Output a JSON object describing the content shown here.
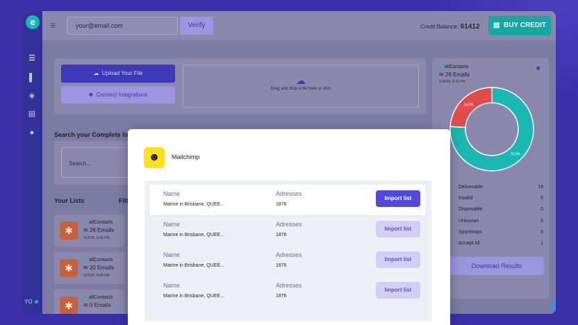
{
  "app": {
    "logo_text": "e",
    "user_initials": "YO"
  },
  "topbar": {
    "email_value": "your@email.com",
    "verify_label": "Verify",
    "credit_label": "Credit Balance:",
    "credit_value": "61412",
    "buy_label": "BUY CREDIT"
  },
  "upload": {
    "upload_label": "Upload Your File",
    "connect_label": "Connect Integrations",
    "drop_text": "Drag and drop a file here or click"
  },
  "search": {
    "heading": "Search your Complete list",
    "placeholder": "Search..."
  },
  "lists": {
    "heading": "Your Lists",
    "filter_label": "Filte",
    "items": [
      {
        "name": "allContacts",
        "count": "26 Emails",
        "date": "11/5/20, 8:42 PM"
      },
      {
        "name": "allContacts",
        "count": "20 Emails",
        "date": "11/5/20, 8:40 PM"
      },
      {
        "name": "allContacts",
        "count": "0 Emails",
        "date": ""
      }
    ]
  },
  "results": {
    "name": "allContacts",
    "count": "26 Emails",
    "date": "11/5/20, 8:42 PM",
    "stats": [
      {
        "label": "Deliverable",
        "value": "19"
      },
      {
        "label": "Invalid",
        "value": "6"
      },
      {
        "label": "Disposable",
        "value": "0"
      },
      {
        "label": "Unknown",
        "value": "0"
      },
      {
        "label": "Spamtraps",
        "value": "0"
      },
      {
        "label": "Accept All",
        "value": "1"
      }
    ],
    "download_label": "Download Results",
    "donut": {
      "segments": [
        {
          "label": "76.0%",
          "value": 76,
          "color": "#19b8b3"
        },
        {
          "label": "24.0%",
          "value": 24,
          "color": "#e34a4a"
        }
      ]
    }
  },
  "modal": {
    "title": "Mailchimp",
    "col_name": "Name",
    "col_addresses": "Adresses",
    "rows": [
      {
        "name": "Marine in Brisbane, QUEE...",
        "addresses": "1876",
        "button": "Import list"
      },
      {
        "name": "Marine in Brisbane, QUEE...",
        "addresses": "1876",
        "button": "Import list"
      },
      {
        "name": "Marine in Brisbane, QUEE...",
        "addresses": "1876",
        "button": "Import list"
      },
      {
        "name": "Marine in Brisbane, QUEE...",
        "addresses": "1876",
        "button": "Import list"
      }
    ]
  },
  "colors": {
    "brand": "#3b2fa8",
    "accent": "#19b8b3",
    "primary_button": "#5249dc",
    "invalid": "#e34a4a"
  }
}
